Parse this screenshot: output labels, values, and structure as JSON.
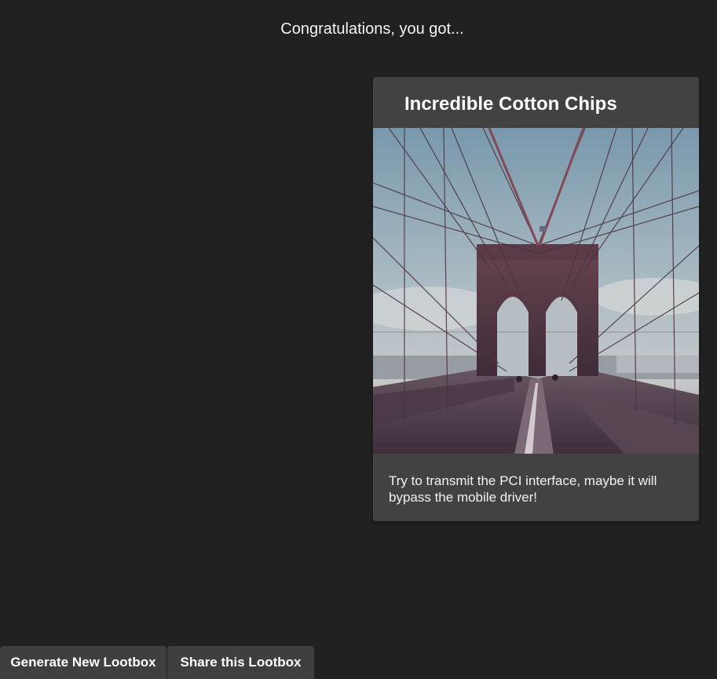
{
  "header": {
    "congrats_text": "Congratulations, you got..."
  },
  "card": {
    "title": "Incredible Cotton Chips",
    "image_alt": "bridge-photo",
    "description": "Try to transmit the PCI interface, maybe it will bypass the mobile driver!"
  },
  "actions": {
    "generate_label": "Generate New Lootbox",
    "share_label": "Share this Lootbox"
  },
  "colors": {
    "background": "#212121",
    "card": "#424242",
    "button": "#3f3f3f",
    "text": "#ffffff"
  }
}
